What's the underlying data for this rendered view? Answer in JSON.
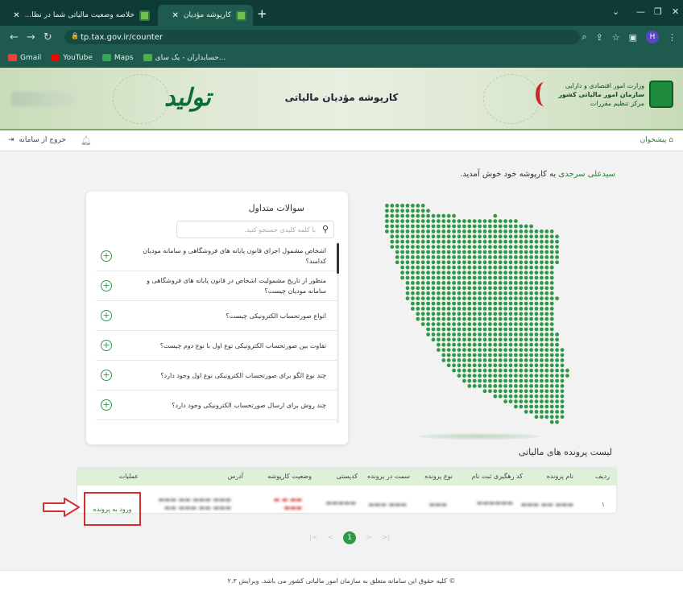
{
  "browser": {
    "tabs": [
      {
        "title": "خلاصه وضعیت مالیاتی شما در نظا...",
        "active": false
      },
      {
        "title": "کارپوشه مؤدیان",
        "active": true
      }
    ],
    "url": "tp.tax.gov.ir/counter",
    "bookmarks": [
      {
        "label": "Gmail",
        "color": "#ea4335"
      },
      {
        "label": "YouTube",
        "color": "#ff0000"
      },
      {
        "label": "Maps",
        "color": "#34a853"
      },
      {
        "label": "حسابداران - یک سای...",
        "color": "#4caf50"
      }
    ],
    "profile_initial": "H"
  },
  "header": {
    "site_title": "کارپوشه مؤدیان مالیاتی",
    "tolid_logo": "تولید",
    "org_lines": [
      "وزارت امور اقتصادی و دارایی",
      "سازمان امور مالیاتی کشور",
      "مرکز تنظیم مقررات"
    ]
  },
  "subnav": {
    "logout": "خروج از سامانه",
    "home": "پیشخوان"
  },
  "welcome": {
    "user": "سیدعلی سرحدی",
    "message": "به کارپوشه خود خوش آمدید."
  },
  "faq": {
    "title": "سوالات متداول",
    "search_placeholder": "با کلمه کلیدی جستجو کنید.",
    "items": [
      "اشخاص مشمول اجرای قانون پایانه های فروشگاهی و سامانه مودیان کدامند؟",
      "منظور از تاریخ مشمولیت اشخاص در قانون پایانه های فروشگاهی و سامانه مودیان چیست؟",
      "انواع صورتحساب الکترونیکی چیست؟",
      "تفاوت بین صورتحساب الکترونیکی نوع اول با نوع دوم چیست؟",
      "چند نوع الگو برای صورتحساب الکترونیکی نوع اول وجود دارد؟",
      "چند روش برای ارسال صورتحساب الکترونیکی وجود دارد؟"
    ]
  },
  "files": {
    "title": "لیست پرونده های مالیاتی",
    "columns": [
      "ردیف",
      "نام پرونده",
      "کد رهگیری ثبت نام",
      "نوع پرونده",
      "سمت در پرونده",
      "کدپستی",
      "وضعیت کارپوشه",
      "آدرس",
      "عملیات"
    ],
    "row": {
      "index": "۱",
      "action": "ورود به پرونده"
    },
    "pagination": {
      "current": "1"
    }
  },
  "footer": {
    "text": "© کلیه حقوق این سامانه متعلق به سازمان امور مالیاتی کشور می باشد. ویرایش ۲.۳"
  },
  "colors": {
    "brand_green": "#2e7d32",
    "header_bg": "#0e3b35",
    "highlight_red": "#d32f2f"
  }
}
